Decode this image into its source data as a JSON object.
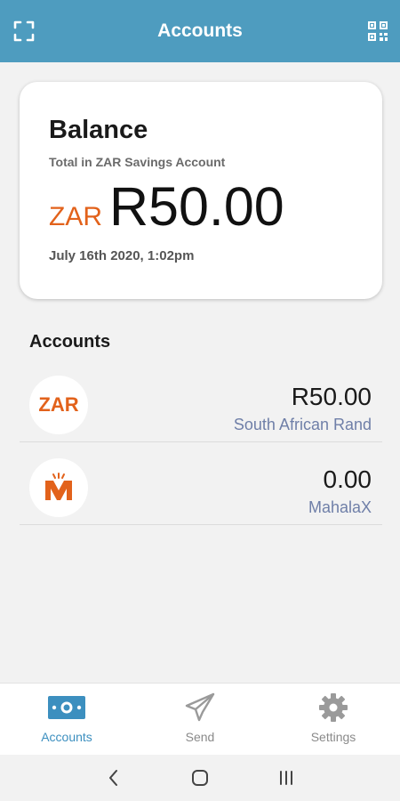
{
  "header": {
    "title": "Accounts",
    "left_icon": "fullscreen-icon",
    "right_icon": "qr-code-icon"
  },
  "balance_card": {
    "heading": "Balance",
    "subtitle": "Total in ZAR Savings Account",
    "currency": "ZAR",
    "amount": "R50.00",
    "date": "July 16th 2020, 1:02pm"
  },
  "accounts_section": {
    "title": "Accounts",
    "items": [
      {
        "logo_text": "ZAR",
        "balance": "R50.00",
        "name": "South African Rand"
      },
      {
        "logo_icon": "mahalax-logo-icon",
        "balance": "0.00",
        "name": "MahalaX"
      }
    ]
  },
  "bottom_nav": {
    "items": [
      {
        "label": "Accounts",
        "icon": "wallet-icon",
        "active": true
      },
      {
        "label": "Send",
        "icon": "paper-plane-icon",
        "active": false
      },
      {
        "label": "Settings",
        "icon": "gear-icon",
        "active": false
      }
    ]
  },
  "colors": {
    "appbar": "#4e9cbf",
    "accent_orange": "#e2621b",
    "active_nav": "#3c8fbf",
    "secondary_text": "#6f7fa8"
  }
}
